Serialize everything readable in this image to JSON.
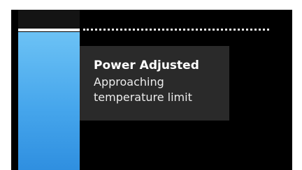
{
  "notification": {
    "title": "Power Adjusted",
    "message_line1": "Approaching",
    "message_line2": "temperature limit"
  },
  "power_indicator": {
    "level_fraction": 0.98,
    "bar_color": "#46a6ec",
    "limit_line_color": "#ffffff"
  },
  "colors": {
    "background": "#000000",
    "card": "#2a2a2a",
    "text": "#ffffff"
  }
}
